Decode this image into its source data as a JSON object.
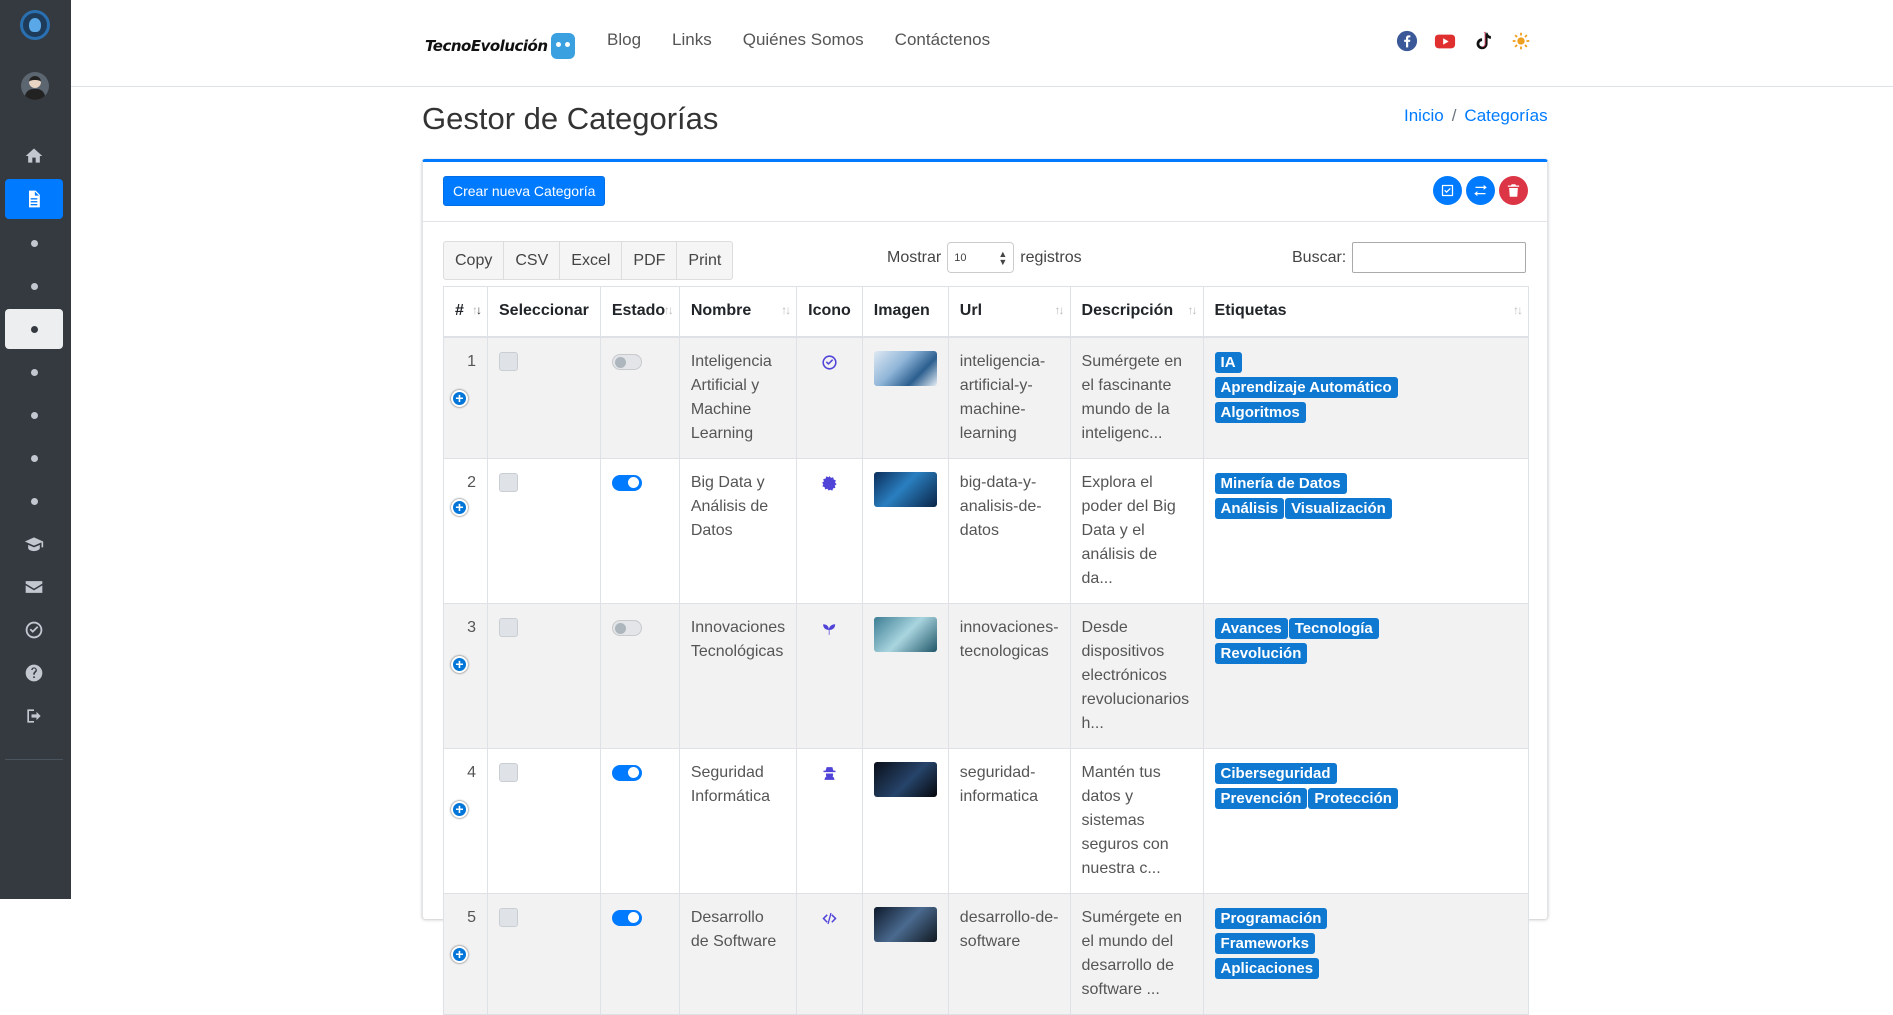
{
  "brand": {
    "name": "TecnoEvolución"
  },
  "nav": [
    "Blog",
    "Links",
    "Quiénes Somos",
    "Contáctenos"
  ],
  "social": [
    {
      "icon": "facebook-icon",
      "color": "#3b5998"
    },
    {
      "icon": "youtube-icon",
      "color": "#e02f2f"
    },
    {
      "icon": "tiktok-icon",
      "color": "#000000"
    },
    {
      "icon": "sun-icon",
      "color": "#f0a020"
    }
  ],
  "page": {
    "title": "Gestor de Categorías"
  },
  "breadcrumb": {
    "home": "Inicio",
    "separator": "/",
    "current": "Categorías"
  },
  "card": {
    "create_button": "Crear nueva Categoría"
  },
  "export_buttons": [
    "Copy",
    "CSV",
    "Excel",
    "PDF",
    "Print"
  ],
  "length": {
    "label_before": "Mostrar",
    "value": "10",
    "label_after": "registros"
  },
  "search": {
    "label": "Buscar:"
  },
  "table": {
    "headers": [
      "#",
      "Seleccionar",
      "Estado",
      "Nombre",
      "Icono",
      "Imagen",
      "Url",
      "Descripción",
      "Etiquetas"
    ],
    "rows": [
      {
        "num": "1",
        "estado": "off",
        "nombre": "Inteligencia Artificial y Machine Learning",
        "icono": "check-circle-icon",
        "url": "inteligencia-artificial-y-machine-learning",
        "descripcion": "Sumérgete en el fascinante mundo de la inteligenc...",
        "etiquetas": [
          "IA",
          "Aprendizaje Automático",
          "Algoritmos"
        ]
      },
      {
        "num": "2",
        "estado": "on",
        "nombre": "Big Data y Análisis de Datos",
        "icono": "cog-icon",
        "url": "big-data-y-analisis-de-datos",
        "descripcion": "Explora el poder del Big Data y el análisis de da...",
        "etiquetas": [
          "Minería de Datos",
          "Análisis",
          "Visualización"
        ]
      },
      {
        "num": "3",
        "estado": "off",
        "nombre": "Innovaciones Tecnológicas",
        "icono": "seedling-icon",
        "url": "innovaciones-tecnologicas",
        "descripcion": "Desde dispositivos electrónicos revolucionarios h...",
        "etiquetas": [
          "Avances",
          "Tecnología",
          "Revolución"
        ]
      },
      {
        "num": "4",
        "estado": "on",
        "nombre": "Seguridad Informática",
        "icono": "user-secret-icon",
        "url": "seguridad-informatica",
        "descripcion": "Mantén tus datos y sistemas seguros con nuestra c...",
        "etiquetas": [
          "Ciberseguridad",
          "Prevención",
          "Protección"
        ]
      },
      {
        "num": "5",
        "estado": "on",
        "nombre": "Desarrollo de Software",
        "icono": "code-icon",
        "url": "desarrollo-de-software",
        "descripcion": "Sumérgete en el mundo del desarrollo de software ...",
        "etiquetas": [
          "Programación",
          "Frameworks",
          "Aplicaciones"
        ]
      }
    ]
  },
  "colors": {
    "primary": "#007bff",
    "danger": "#dc3545",
    "sidebar": "#343a40",
    "tag": "#0f78d1"
  }
}
